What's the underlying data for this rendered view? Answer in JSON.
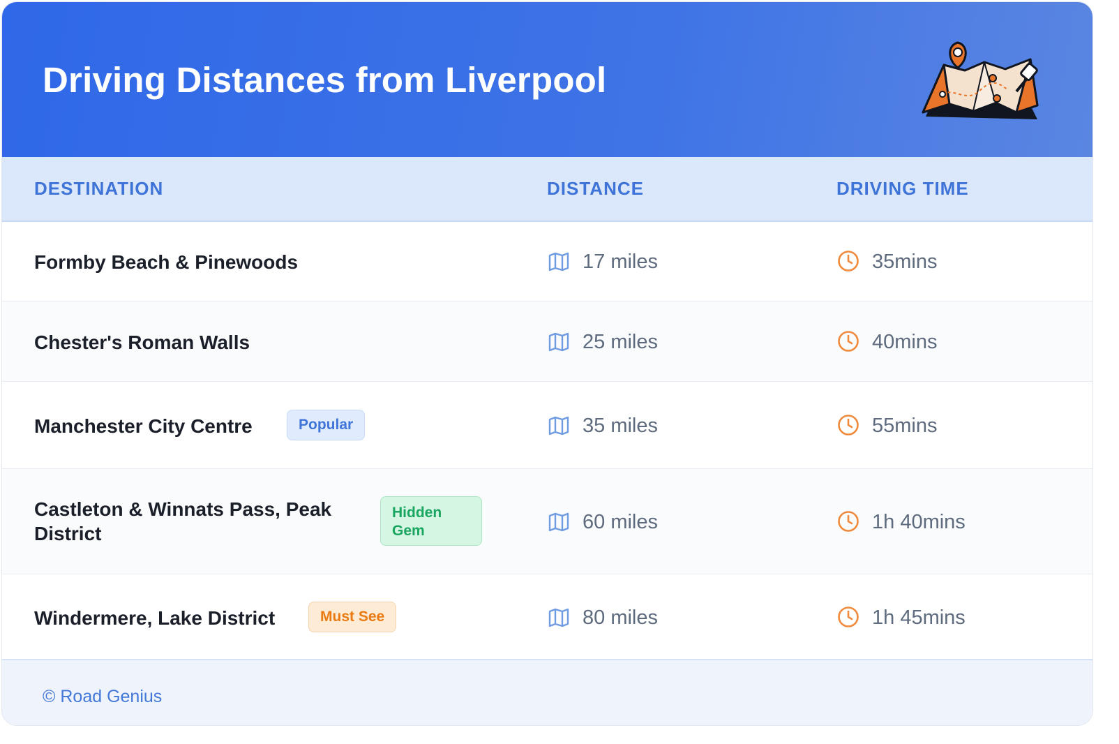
{
  "header": {
    "title": "Driving Distances from Liverpool"
  },
  "table": {
    "columns": [
      "DESTINATION",
      "DISTANCE",
      "DRIVING TIME"
    ],
    "rows": [
      {
        "destination": "Formby Beach & Pinewoods",
        "badge": "",
        "distance": "17 miles",
        "time": "35mins"
      },
      {
        "destination": "Chester's Roman Walls",
        "badge": "",
        "distance": "25 miles",
        "time": "40mins"
      },
      {
        "destination": "Manchester City Centre",
        "badge": "Popular",
        "distance": "35 miles",
        "time": "55mins"
      },
      {
        "destination": "Castleton & Winnats Pass, Peak District",
        "badge": "Hidden Gem",
        "distance": "60 miles",
        "time": "1h 40mins"
      },
      {
        "destination": "Windermere, Lake District",
        "badge": "Must See",
        "distance": "80 miles",
        "time": "1h 45mins"
      }
    ]
  },
  "icons": {
    "header": "folded-map-with-pins-icon",
    "distance": "map-icon",
    "time": "clock-icon"
  },
  "colors": {
    "header_bg": "#2f68e8",
    "accent_blue": "#3e73d8",
    "clock_orange": "#f08a3c",
    "badge_popular": "#e0ecfd",
    "badge_gem": "#d4f6e2",
    "badge_mustsee": "#fdebd6"
  },
  "footer": {
    "credit": "© Road Genius"
  }
}
